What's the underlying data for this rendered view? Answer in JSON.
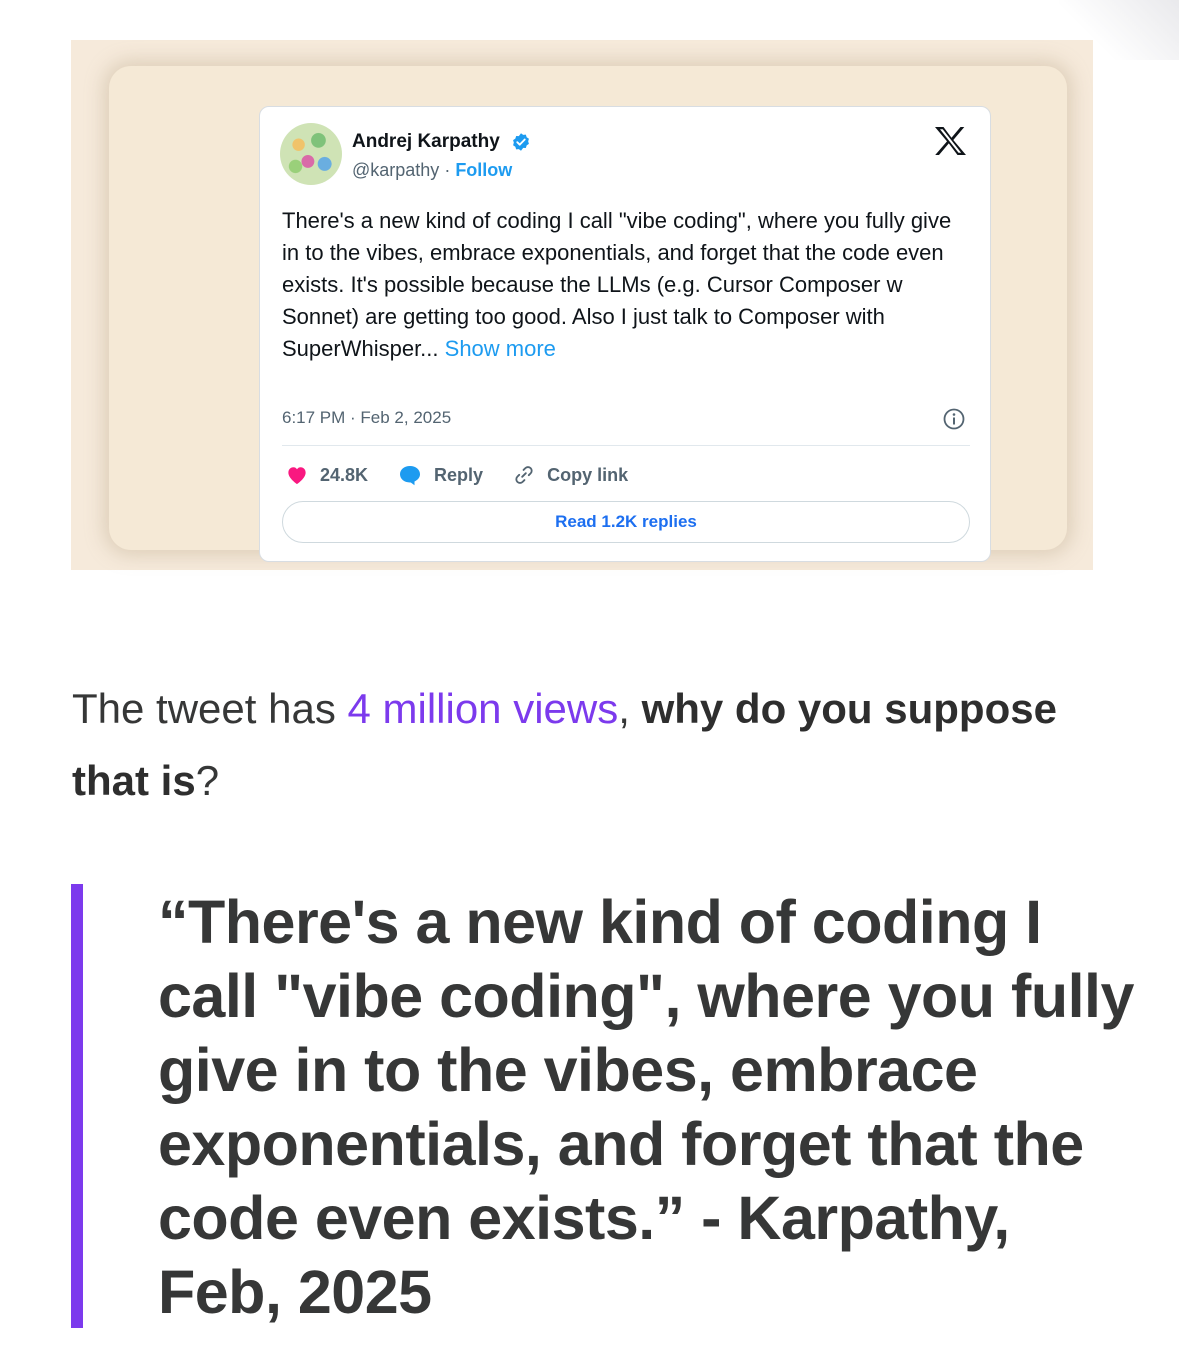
{
  "tweet": {
    "author_name": "Andrej Karpathy",
    "handle": "@karpathy",
    "separator": " · ",
    "follow_label": "Follow",
    "body": "There's a new kind of coding I call \"vibe coding\", where you fully give in to the vibes, embrace exponentials, and forget that the code even exists. It's possible because the LLMs (e.g. Cursor Composer w Sonnet) are getting too good. Also I just talk to Composer with SuperWhisper... ",
    "show_more_label": "Show more",
    "timestamp": "6:17 PM · Feb 2, 2025",
    "likes": "24.8K",
    "reply_label": "Reply",
    "copy_link_label": "Copy link",
    "read_replies_label": "Read 1.2K replies",
    "colors": {
      "accent": "#1d9bf0",
      "heart": "#f91880"
    }
  },
  "article": {
    "para_prefix": "The tweet has ",
    "views_link": "4 million views",
    "para_comma": ", ",
    "bold_question": "why do you suppose that is",
    "question_mark": "?",
    "quote": "“There's a new kind of coding I call \"vibe coding\", where you fully give in to the vibes, embrace exponentials, and forget that the code even exists.” - Karpathy, Feb, 2025",
    "accent_color": "#7c3aed"
  }
}
